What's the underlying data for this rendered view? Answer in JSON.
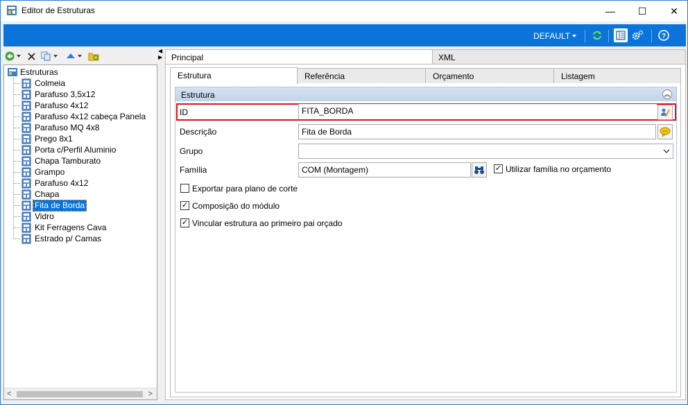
{
  "window": {
    "title": "Editor de Estruturas",
    "minimize": "—",
    "maximize": "☐",
    "close": "✕"
  },
  "ribbon": {
    "profile": "DEFAULT"
  },
  "tree": {
    "root": "Estruturas",
    "items": [
      "Colmeia",
      "Parafuso 3,5x12",
      "Parafuso 4x12",
      "Parafuso 4x12  cabeça Panela",
      "Parafuso MQ 4x8",
      "Prego 8x1",
      "Porta c/Perfil Aluminio",
      "Chapa Tamburato",
      "Grampo",
      "Parafuso 4x12",
      "Chapa",
      "Fita de Borda",
      "Vidro",
      "Kit Ferragens Cava",
      "Estrado p/ Camas"
    ],
    "selected_index": 11
  },
  "tabs": {
    "principal": "Principal",
    "xml": "XML"
  },
  "subtabs": {
    "estrutura": "Estrutura",
    "referencia": "Referência",
    "orcamento": "Orçamento",
    "listagem": "Listagem"
  },
  "group": {
    "title": "Estrutura"
  },
  "form": {
    "id_label": "ID",
    "id_value": "FITA_BORDA",
    "descricao_label": "Descrição",
    "descricao_value": "Fita de Borda",
    "grupo_label": "Grupo",
    "grupo_value": "",
    "familia_label": "Família",
    "familia_value": "COM (Montagem)",
    "utilizar_familia_label": "Utilizar família no orçamento",
    "utilizar_familia_checked": true,
    "exportar_label": "Exportar para plano de corte",
    "exportar_checked": false,
    "composicao_label": "Composição do módulo",
    "composicao_checked": true,
    "vincular_label": "Vincular estrutura ao primeiro pai orçado",
    "vincular_checked": true
  },
  "colors": {
    "accent": "#0a74da",
    "highlight_border": "#e01020",
    "group_header": "#c9d8ee"
  }
}
